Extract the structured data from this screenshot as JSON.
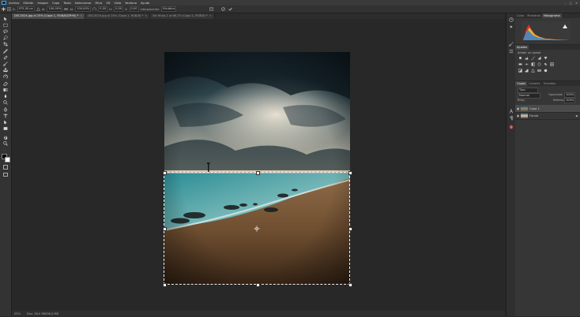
{
  "menu": {
    "items": [
      "Archivo",
      "Edición",
      "Imagen",
      "Capa",
      "Texto",
      "Seleccionar",
      "Filtro",
      "3D",
      "Vista",
      "Ventana",
      "Ayuda"
    ]
  },
  "options_bar": {
    "fields": [
      {
        "label": "X:",
        "value": "975,00 px"
      },
      {
        "label": "Al:",
        "value": "100,00%"
      },
      {
        "label": "Al:",
        "value": "100,00%"
      },
      {
        "label": "",
        "value": "0,00"
      },
      {
        "label": "H:",
        "value": "0,00"
      },
      {
        "label": "V:",
        "value": "0,00"
      }
    ],
    "interpolation_label": "Interpolación:",
    "interpolation_value": "Bicúbica"
  },
  "tabs": [
    {
      "label": "DSC3024.jpg al 25% (Capa 1, RGB/8/CMYK) *",
      "active": true
    },
    {
      "label": "DSC3024.jpg al 25% (Capa 1, RGB/8) *",
      "active": false
    },
    {
      "label": "Sin título-1 al 66,7% (Capa 1, RGB/8) *",
      "active": false
    }
  ],
  "status": {
    "zoom": "25%",
    "doc": "Doc: 36,0 MB/36,0 MB"
  },
  "panels": {
    "top_tabs": [
      "Color",
      "Muestras",
      "Histograma"
    ],
    "adjust_tabs": [
      "Ajustes"
    ],
    "adjust_hint": "Añadir un ajuste",
    "layers_tabs": [
      "Capas",
      "Canales",
      "Trazados"
    ],
    "filter_label": "Tipo",
    "blend_mode": "Normal",
    "opacity_label": "Opacidad:",
    "opacity_value": "100%",
    "lock_label": "Bloq.:",
    "fill_label": "Relleno:",
    "fill_value": "100%",
    "layers": [
      {
        "name": "Capa 1",
        "selected": true
      },
      {
        "name": "Fondo",
        "selected": false
      }
    ]
  },
  "icons": {
    "toolbar": [
      "move-icon",
      "marquee-icon",
      "lasso-icon",
      "quick-select-icon",
      "crop-icon",
      "eyedropper-icon",
      "healing-icon",
      "brush-icon",
      "stamp-icon",
      "history-brush-icon",
      "eraser-icon",
      "gradient-icon",
      "blur-icon",
      "dodge-icon",
      "pen-icon",
      "type-icon",
      "path-select-icon",
      "shape-icon",
      "hand-icon",
      "zoom-icon"
    ],
    "dock": [
      "history-icon",
      "play-icon",
      "brush-settings-icon",
      "properties-icon",
      "character-icon",
      "paragraph-icon",
      "info-icon"
    ]
  },
  "colors": {
    "accent": "#31a8ff",
    "foreground": "#000000",
    "background": "#ffffff"
  }
}
